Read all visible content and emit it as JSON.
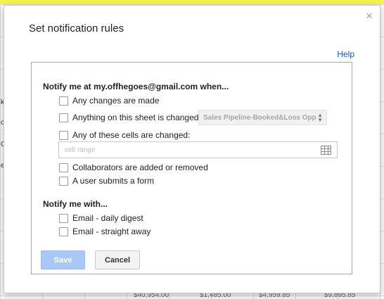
{
  "background": {
    "row_letters": [
      "k",
      "o",
      "C",
      "e"
    ],
    "bottom_values": [
      "$40,954.00",
      "$1,485.00",
      "$4,959.85",
      "$9,895.85"
    ]
  },
  "dialog": {
    "title": "Set notification rules",
    "help_label": "Help",
    "close_glyph": "×",
    "heading_when": "Notify me at my.offhegoes@gmail.com when...",
    "options_when": [
      {
        "label": "Any changes are made",
        "checked": false
      },
      {
        "label": "Anything on this sheet is changed:",
        "checked": false
      },
      {
        "label": "Any of these cells are changed:",
        "checked": false
      },
      {
        "label": "Collaborators are added or removed",
        "checked": false
      },
      {
        "label": "A user submits a form",
        "checked": false
      }
    ],
    "sheet_select_value": "Sales Pipeline-Booked&Loss Opp",
    "cell_range_placeholder": "cell range",
    "heading_with": "Notify me with...",
    "options_with": [
      {
        "label": "Email - daily digest",
        "checked": false
      },
      {
        "label": "Email - straight away",
        "checked": false
      }
    ],
    "save_label": "Save",
    "cancel_label": "Cancel"
  },
  "colors": {
    "primary_disabled": "#a9c7f7",
    "link": "#1155cc",
    "spreadsheet_header": "#f4f44a"
  },
  "icons": {
    "close": "close-icon",
    "sheet_select": "up-down-arrows-icon",
    "range_picker": "grid-icon"
  }
}
